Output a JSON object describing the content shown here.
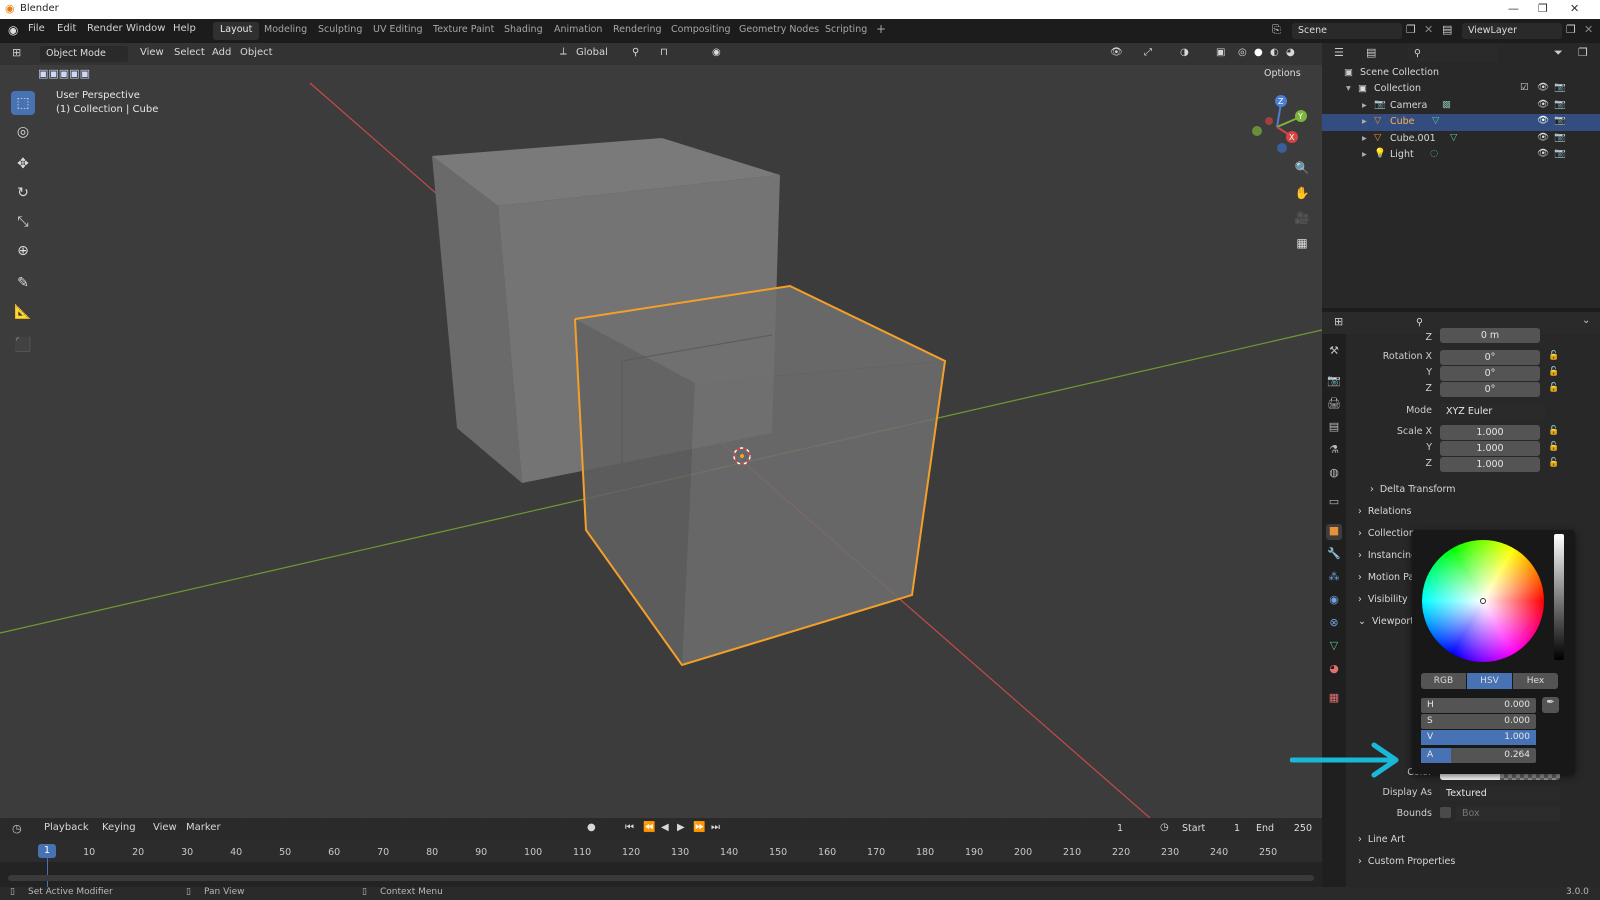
{
  "app": {
    "title": "Blender",
    "version": "3.0.0"
  },
  "menus": [
    "File",
    "Edit",
    "Render",
    "Window",
    "Help"
  ],
  "workspaces": [
    "Layout",
    "Modeling",
    "Sculpting",
    "UV Editing",
    "Texture Paint",
    "Shading",
    "Animation",
    "Rendering",
    "Compositing",
    "Geometry Nodes",
    "Scripting"
  ],
  "active_workspace": "Layout",
  "add_workspace_icon": "+",
  "scene": {
    "name": "Scene",
    "view_layer": "ViewLayer"
  },
  "viewport": {
    "mode": "Object Mode",
    "menus": [
      "View",
      "Select",
      "Add",
      "Object"
    ],
    "transform_orientation": "Global",
    "options_label": "Options",
    "overlay_title": "User Perspective",
    "overlay_subtitle": "(1) Collection | Cube",
    "gizmo_axes": [
      "Z",
      "Y",
      "X"
    ]
  },
  "outliner": {
    "root": "Scene Collection",
    "collection": "Collection",
    "items": [
      {
        "name": "Camera",
        "selected": false
      },
      {
        "name": "Cube",
        "selected": true
      },
      {
        "name": "Cube.001",
        "selected": false
      },
      {
        "name": "Light",
        "selected": false
      }
    ]
  },
  "properties": {
    "location_z": "0 m",
    "rotation_label": "Rotation X",
    "rotation": [
      "0°",
      "0°",
      "0°"
    ],
    "axis_y": "Y",
    "axis_z": "Z",
    "axis_top": "Z",
    "mode_label": "Mode",
    "mode_value": "XYZ Euler",
    "scale_label": "Scale X",
    "scale": [
      "1.000",
      "1.000",
      "1.000"
    ],
    "delta_transform": "Delta Transform",
    "panels": [
      "Relations",
      "Collections",
      "Instancing",
      "Motion Paths",
      "Visibility",
      "Viewport Display"
    ],
    "color_label": "Color",
    "display_as_label": "Display As",
    "display_as_value": "Textured",
    "bounds_label": "Bounds",
    "bounds_value": "Box",
    "line_art": "Line Art",
    "custom_properties": "Custom Properties"
  },
  "color_picker": {
    "tabs": [
      "RGB",
      "HSV",
      "Hex"
    ],
    "active_tab": "HSV",
    "values": [
      {
        "label": "H",
        "value": "0.000",
        "fill": 0
      },
      {
        "label": "S",
        "value": "0.000",
        "fill": 0
      },
      {
        "label": "V",
        "value": "1.000",
        "fill": 1.0
      },
      {
        "label": "A",
        "value": "0.264",
        "fill": 0.264
      }
    ],
    "highlight_color": "#4772b3"
  },
  "annotation_arrow_color": "#1ab8d8",
  "timeline": {
    "menus": [
      "Playback",
      "Keying",
      "View",
      "Marker"
    ],
    "current_frame": "1",
    "start_label": "Start",
    "start": "1",
    "end_label": "End",
    "end": "250",
    "ticks": [
      "1",
      "10",
      "20",
      "30",
      "40",
      "50",
      "60",
      "70",
      "80",
      "90",
      "100",
      "110",
      "120",
      "130",
      "140",
      "150",
      "160",
      "170",
      "180",
      "190",
      "200",
      "210",
      "220",
      "230",
      "240",
      "250"
    ]
  },
  "status_bar": [
    "Set Active Modifier",
    "Pan View",
    "Context Menu"
  ],
  "colors": {
    "selection_orange": "#f4a028",
    "accent_blue": "#4772b3",
    "x_axis": "#d64545",
    "y_axis": "#7db53c"
  }
}
